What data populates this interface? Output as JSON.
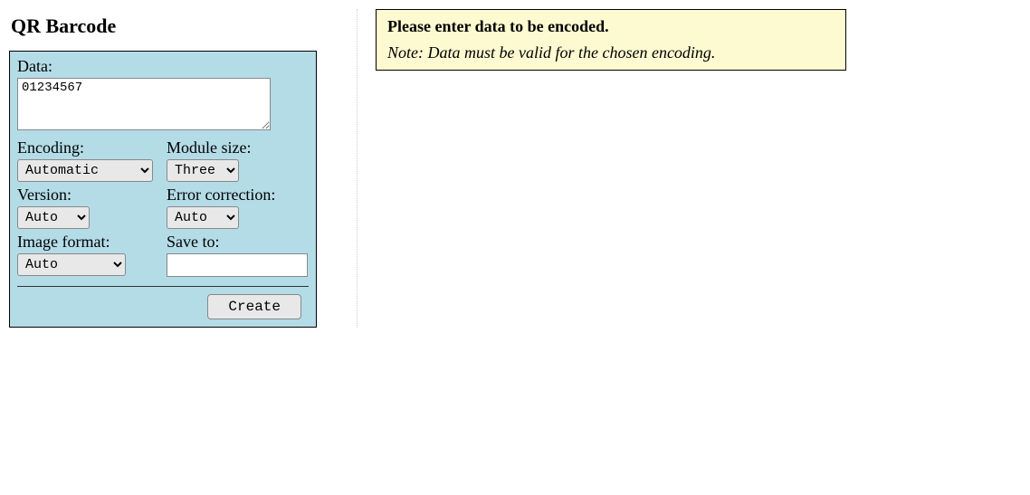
{
  "page_title": "QR Barcode",
  "form": {
    "data_label": "Data:",
    "data_value": "01234567",
    "encoding_label": "Encoding:",
    "encoding_value": "Automatic",
    "module_size_label": "Module size:",
    "module_size_value": "Three",
    "version_label": "Version:",
    "version_value": "Auto",
    "error_correction_label": "Error correction:",
    "error_correction_value": "Auto",
    "image_format_label": "Image format:",
    "image_format_value": "Auto",
    "save_to_label": "Save to:",
    "save_to_value": "",
    "create_button": "Create"
  },
  "message": {
    "title": "Please enter data to be encoded.",
    "note": "Note: Data must be valid for the chosen encoding."
  }
}
